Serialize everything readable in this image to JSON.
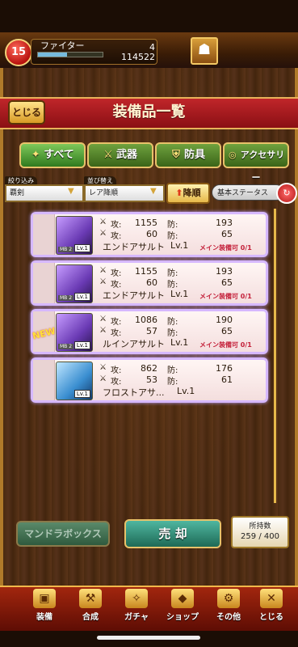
{
  "status": {
    "level": "15",
    "job": "ファイター",
    "gold_top": "4",
    "gold": "114522"
  },
  "header": {
    "back_label": "とじる",
    "title": "装備品一覧"
  },
  "categories": [
    {
      "label": "すべて",
      "icon": "star-icon"
    },
    {
      "label": "武器",
      "icon": "sword-icon"
    },
    {
      "label": "防具",
      "icon": "armor-icon"
    },
    {
      "label": "アクセサリー",
      "icon": "ring-icon"
    }
  ],
  "filters": {
    "narrow_label": "絞り込み",
    "narrow_value": "覇剣",
    "sort_label": "並び替え",
    "sort_value": "レア降順",
    "order_button": "降順",
    "status_button": "基本ステータス"
  },
  "stat_labels": {
    "atk": "攻:",
    "def": "防:"
  },
  "items": [
    {
      "name": "エンドアサルト",
      "level": "Lv.1",
      "atk1": "1155",
      "def1": "193",
      "atk2": "60",
      "def2": "65",
      "slot": "メイン装備可 0/1",
      "mb": "MB 2",
      "icon_level": "Lv.1",
      "is_new": false
    },
    {
      "name": "エンドアサルト",
      "level": "Lv.1",
      "atk1": "1155",
      "def1": "193",
      "atk2": "60",
      "def2": "65",
      "slot": "メイン装備可 0/1",
      "mb": "MB 2",
      "icon_level": "Lv.1",
      "is_new": false
    },
    {
      "name": "ルインアサルト",
      "level": "Lv.1",
      "atk1": "1086",
      "def1": "190",
      "atk2": "57",
      "def2": "65",
      "slot": "メイン装備可 0/1",
      "mb": "MB 2",
      "icon_level": "Lv.1",
      "is_new": true,
      "new_label": "NEW"
    },
    {
      "name": "フロストアサ...",
      "level": "Lv.1",
      "atk1": "862",
      "def1": "176",
      "atk2": "53",
      "def2": "61",
      "slot": "",
      "mb": "",
      "icon_level": "Lv.1",
      "is_new": false
    }
  ],
  "bottom": {
    "mandora_label": "マンドラボックス",
    "sell_label": "売 却",
    "capacity_label": "所持数",
    "capacity_value": "259 / 400"
  },
  "nav": [
    {
      "label": "装備",
      "icon": "chest-icon"
    },
    {
      "label": "合成",
      "icon": "hammer-icon"
    },
    {
      "label": "ガチャ",
      "icon": "gacha-icon"
    },
    {
      "label": "ショップ",
      "icon": "shop-icon"
    },
    {
      "label": "その他",
      "icon": "gear-icon"
    },
    {
      "label": "とじる",
      "icon": "close-icon"
    }
  ]
}
